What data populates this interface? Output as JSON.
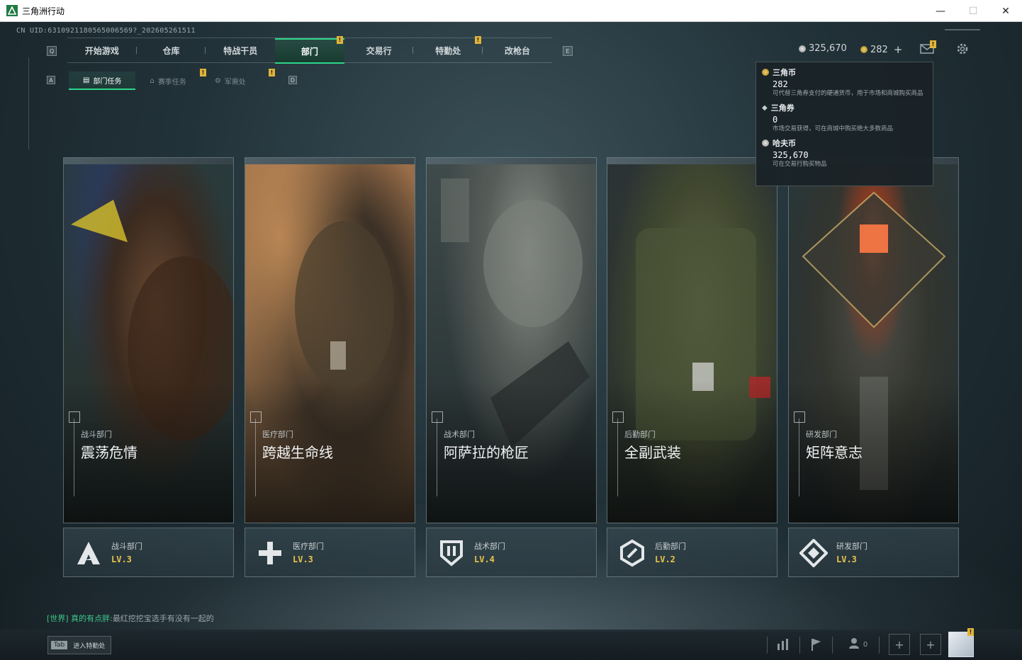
{
  "window": {
    "title": "三角洲行动",
    "controls": {
      "minimize": "—",
      "maximize": "☐",
      "close": "✕"
    }
  },
  "uid": "CN UID:6310921180565006569?_202605261511",
  "main_nav": {
    "left_key": "Q",
    "right_key": "E",
    "items": [
      {
        "label": "开始游戏",
        "active": false,
        "badge": false
      },
      {
        "label": "仓库",
        "active": false,
        "badge": false
      },
      {
        "label": "特战干员",
        "active": false,
        "badge": false
      },
      {
        "label": "部门",
        "active": true,
        "badge": true
      },
      {
        "label": "交易行",
        "active": false,
        "badge": false
      },
      {
        "label": "特勤处",
        "active": false,
        "badge": true
      },
      {
        "label": "改枪台",
        "active": false,
        "badge": false
      }
    ]
  },
  "sub_nav": {
    "left_key": "A",
    "right_key": "D",
    "items": [
      {
        "label": "部门任务",
        "active": true,
        "badge": false
      },
      {
        "label": "赛季任务",
        "active": false,
        "badge": true
      },
      {
        "label": "军需处",
        "active": false,
        "badge": true
      }
    ]
  },
  "currency": {
    "hafcoin": "325,670",
    "delta_coin": "282",
    "plus": "+",
    "badge": "!"
  },
  "currency_popup": {
    "entries": [
      {
        "name": "三角币",
        "value": "282",
        "desc": "可代替三角券支付的硬通货币，用于市场和商城购买商品"
      },
      {
        "name": "三角券",
        "value": "0",
        "desc": "市场交易获得，可在商城中购买绝大多数商品"
      },
      {
        "name": "哈夫币",
        "value": "325,670",
        "desc": "可在交易行购买物品"
      }
    ]
  },
  "cards": [
    {
      "dept": "战斗部门",
      "name": "震荡危情",
      "plate_title": "战斗部门",
      "level": "LV.3",
      "emblem": "assault-emblem-icon"
    },
    {
      "dept": "医疗部门",
      "name": "跨越生命线",
      "plate_title": "医疗部门",
      "level": "LV.3",
      "emblem": "medical-cross-icon"
    },
    {
      "dept": "战术部门",
      "name": "阿萨拉的枪匠",
      "plate_title": "战术部门",
      "level": "LV.4",
      "emblem": "shield-emblem-icon"
    },
    {
      "dept": "后勤部门",
      "name": "全副武装",
      "plate_title": "后勤部门",
      "level": "LV.2",
      "emblem": "logistics-emblem-icon"
    },
    {
      "dept": "研发部门",
      "name": "矩阵意志",
      "plate_title": "研发部门",
      "level": "LV.3",
      "emblem": "research-emblem-icon"
    }
  ],
  "chat": {
    "channel": "[世界]",
    "sender": "真的有点胖:",
    "message": "最红挖挖宝选手有没有一起的"
  },
  "bottom_bar": {
    "tab_key": "Tab",
    "tab_label": "进入特勤处",
    "friends_count": "0",
    "avatar_badge": "!"
  },
  "colors": {
    "accent": "#2fd58a",
    "badge": "#e0b33a",
    "level": "#e8c34a"
  }
}
